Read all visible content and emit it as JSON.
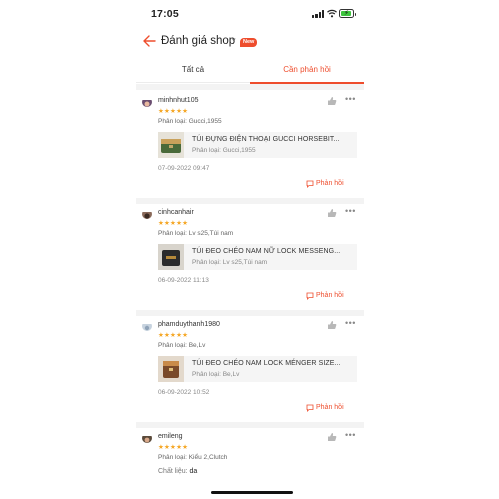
{
  "status_bar": {
    "time": "17:05"
  },
  "header": {
    "title": "Đánh giá shop",
    "caret": "▾",
    "badge": "New"
  },
  "tabs": [
    {
      "label": "Tất cả",
      "active": false
    },
    {
      "label": "Cần phản hồi",
      "active": true
    }
  ],
  "reviews": [
    {
      "username": "minhnhut105",
      "stars": "★★★★★",
      "variant": "Phân loại: Gucci,1955",
      "product_name": "TÚI ĐỰNG ĐIỆN THOẠI GUCCI HORSEBIT...",
      "product_variant": "Phân loại: Gucci,1955",
      "date": "07-09-2022 09:47",
      "reply_label": "Phản hồi"
    },
    {
      "username": "cinhcanhair",
      "stars": "★★★★★",
      "variant": "Phân loại: Lv s25,Túi nam",
      "product_name": "TÚI ĐEO CHÉO NAM NỮ LOCK MESSENG...",
      "product_variant": "Phân loại: Lv s25,Túi nam",
      "date": "06-09-2022 11:13",
      "reply_label": "Phản hồi"
    },
    {
      "username": "phamduythanh1980",
      "stars": "★★★★★",
      "variant": "Phân loại: Be,Lv",
      "product_name": "TÚI ĐEO CHÉO NAM LOCK MÉNGER SIZE...",
      "product_variant": "Phân loại: Be,Lv",
      "date": "06-09-2022 10:52",
      "reply_label": "Phản hồi"
    },
    {
      "username": "emileng",
      "stars": "★★★★★",
      "variant": "Phân loại: Kiểu 2,Clutch",
      "material_label": "Chất liệu:",
      "material_value": "da"
    }
  ],
  "icons": [
    "back-arrow-icon",
    "signal-icon",
    "wifi-icon",
    "battery-icon",
    "like-icon",
    "more-icon",
    "reply-icon"
  ],
  "colors": {
    "accent": "#ee4d2d",
    "star": "#f5a623"
  }
}
